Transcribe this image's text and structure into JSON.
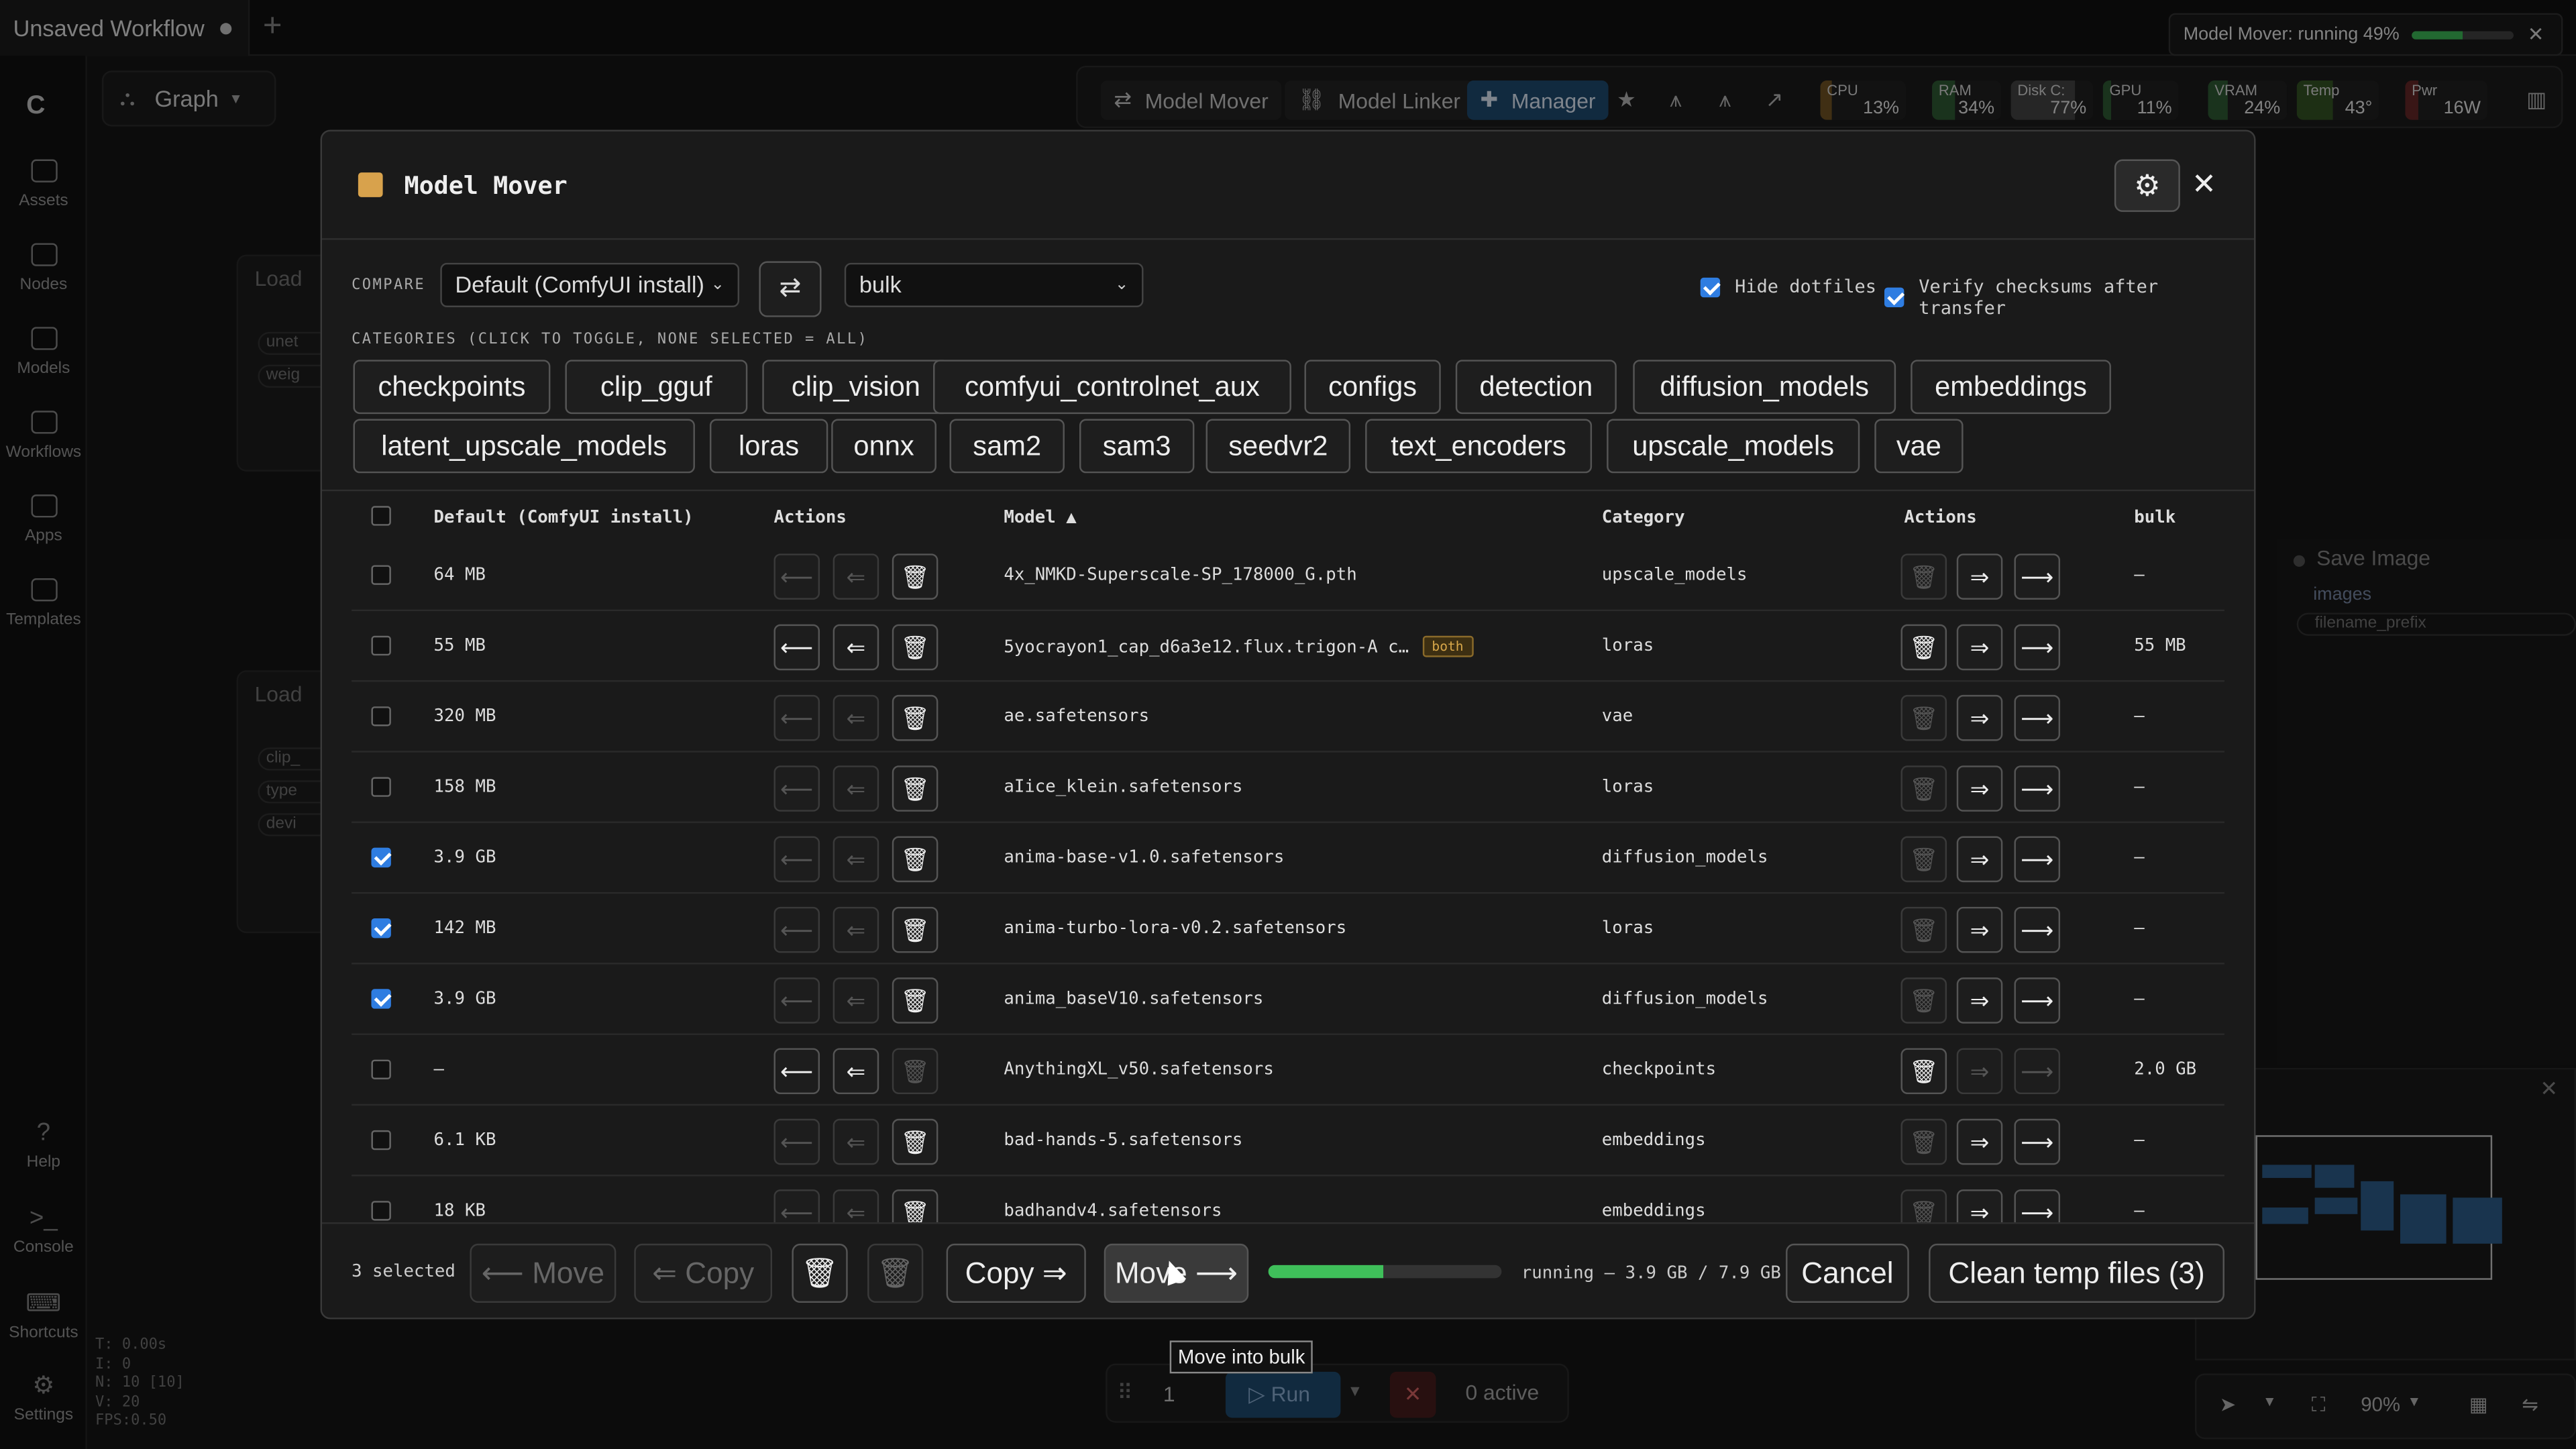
{
  "workflow_tab": {
    "title": "Unsaved Workflow"
  },
  "status": {
    "text": "Model Mover: running 49%",
    "progress": 0.49
  },
  "sidebar": {
    "items": [
      "Assets",
      "Nodes",
      "Models",
      "Workflows",
      "Apps",
      "Templates"
    ],
    "bottom": [
      "Help",
      "Console",
      "Shortcuts",
      "Settings"
    ]
  },
  "stats": [
    "T: 0.00s",
    "I: 0",
    "N: 10 [10]",
    "V: 20",
    "FPS:0.50"
  ],
  "graph": {
    "label": "Graph"
  },
  "toolbar": {
    "buttons": [
      "Model Mover",
      "Model Linker",
      "Manager"
    ],
    "meters": [
      {
        "label": "CPU",
        "value": "13%",
        "level": 0.13,
        "color": "#c98a2a"
      },
      {
        "label": "RAM",
        "value": "34%",
        "level": 0.34,
        "color": "#3f9a4a"
      },
      {
        "label": "Disk C:",
        "value": "77%",
        "level": 0.77,
        "color": "#6a6a6a"
      },
      {
        "label": "GPU",
        "value": "11%",
        "level": 0.11,
        "color": "#3f9a4a"
      },
      {
        "label": "VRAM",
        "value": "24%",
        "level": 0.24,
        "color": "#3f9a4a"
      },
      {
        "label": "Temp",
        "value": "43°",
        "level": 0.43,
        "color": "#4a8a2a"
      },
      {
        "label": "Pwr",
        "value": "16W",
        "level": 0.16,
        "color": "#b03030"
      }
    ]
  },
  "bg_nodes": {
    "load1": "Load",
    "load2": "Load",
    "chips1": [
      "unet",
      "weig"
    ],
    "chips2": [
      "clip_",
      "type",
      "devi"
    ],
    "save_title": "Save Image",
    "save_input": "images",
    "save_widget": "filename_prefix"
  },
  "modal": {
    "title": "Model Mover",
    "compare_label": "COMPARE",
    "left_select": "Default (ComfyUI install)",
    "right_select": "bulk",
    "hide_dotfiles": "Hide dotfiles",
    "verify": "Verify checksums after transfer",
    "categories_label": "CATEGORIES (CLICK TO TOGGLE, NONE SELECTED = ALL)",
    "categories": [
      "checkpoints",
      "clip_gguf",
      "clip_vision",
      "comfyui_controlnet_aux",
      "configs",
      "detection",
      "diffusion_models",
      "embeddings",
      "latent_upscale_models",
      "loras",
      "onnx",
      "sam2",
      "sam3",
      "seedvr2",
      "text_encoders",
      "upscale_models",
      "vae"
    ],
    "headers": {
      "left": "Default (ComfyUI install)",
      "actions": "Actions",
      "model": "Model ▲",
      "category": "Category",
      "actions2": "Actions",
      "right": "bulk"
    },
    "rows": [
      {
        "checked": false,
        "left": "64 MB",
        "model": "4x_NMKD-Superscale-SP_178000_G.pth",
        "badge": "",
        "category": "upscale_models",
        "right": "–"
      },
      {
        "checked": false,
        "left": "55 MB",
        "model": "5yocrayon1_cap_d6a3e12.flux.trigon-A c…",
        "badge": "both",
        "category": "loras",
        "right": "55 MB"
      },
      {
        "checked": false,
        "left": "320 MB",
        "model": "ae.safetensors",
        "badge": "",
        "category": "vae",
        "right": "–"
      },
      {
        "checked": false,
        "left": "158 MB",
        "model": "aIice_klein.safetensors",
        "badge": "",
        "category": "loras",
        "right": "–"
      },
      {
        "checked": true,
        "left": "3.9 GB",
        "model": "anima-base-v1.0.safetensors",
        "badge": "",
        "category": "diffusion_models",
        "right": "–"
      },
      {
        "checked": true,
        "left": "142 MB",
        "model": "anima-turbo-lora-v0.2.safetensors",
        "badge": "",
        "category": "loras",
        "right": "–"
      },
      {
        "checked": true,
        "left": "3.9 GB",
        "model": "anima_baseV10.safetensors",
        "badge": "",
        "category": "diffusion_models",
        "right": "–"
      },
      {
        "checked": false,
        "left": "–",
        "model": "AnythingXL_v50.safetensors",
        "badge": "",
        "category": "checkpoints",
        "right": "2.0 GB"
      },
      {
        "checked": false,
        "left": "6.1 KB",
        "model": "bad-hands-5.safetensors",
        "badge": "",
        "category": "embeddings",
        "right": "–"
      },
      {
        "checked": false,
        "left": "18 KB",
        "model": "badhandv4.safetensors",
        "badge": "",
        "category": "embeddings",
        "right": "–"
      }
    ],
    "footer": {
      "selected": "3 selected",
      "move_left": "⟵ Move",
      "copy_left": "⇐ Copy",
      "copy_right": "Copy ⇒",
      "move_right": "Move ⟶",
      "progress_text": "running — 3.9 GB / 7.9 GB",
      "progress": 0.49,
      "cancel": "Cancel",
      "clean": "Clean temp files (3)"
    }
  },
  "tooltip": "Move into bulk",
  "runbar": {
    "count": "1",
    "run": "Run",
    "active": "0 active"
  },
  "zoom": "90%"
}
